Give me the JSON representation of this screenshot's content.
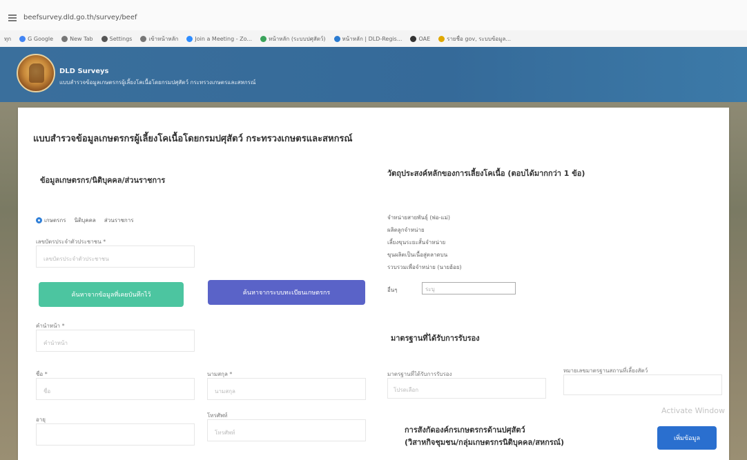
{
  "browser": {
    "url": "beefsurvey.dld.go.th/survey/beef",
    "bookmarks": [
      {
        "label": "G Google",
        "icon": "google-icon",
        "color": "#4285f4"
      },
      {
        "label": "New Tab",
        "icon": "globe-icon",
        "color": "#777777"
      },
      {
        "label": "Settings",
        "icon": "gear-icon",
        "color": "#555555"
      },
      {
        "label": "เข้าหน้าหลัก",
        "icon": "globe-icon",
        "color": "#777777"
      },
      {
        "label": "Join a Meeting - Zo...",
        "icon": "zoom-icon",
        "color": "#2d8cff"
      },
      {
        "label": "หน้าหลัก (ระบบปศุสัตว์)",
        "icon": "leaf-icon",
        "color": "#3aa35b"
      },
      {
        "label": "หน้าหลัก | DLD-Regis...",
        "icon": "grid-icon",
        "color": "#2a7bd1"
      },
      {
        "label": "OAE",
        "icon": "globe-icon",
        "color": "#333333"
      },
      {
        "label": "รายชื่อ gov, ระบบข้อมูล...",
        "icon": "apps-icon",
        "color": "#e0a800"
      }
    ]
  },
  "header": {
    "title": "DLD Surveys",
    "subtitle": "แบบสำรวจข้อมูลเกษตรกรผู้เลี้ยงโคเนื้อโดยกรมปศุสัตว์ กระทรวงเกษตรและสหกรณ์",
    "logo": "dld-seal"
  },
  "form": {
    "title": "แบบสำรวจข้อมูลเกษตรกรผู้เลี้ยงโคเนื้อโดยกรมปศุสัตว์ กระทรวงเกษตรและสหกรณ์",
    "farmer_section": {
      "title": "ข้อมูลเกษตรกร/นิติบุคคล/ส่วนราชการ",
      "radio_options": [
        "เกษตรกร",
        "นิติบุคคล",
        "ส่วนราชการ"
      ],
      "selected": "เกษตรกร",
      "id_label": "เลขบัตรประจำตัวประชาชน *",
      "id_placeholder": "เลขบัตรประจำตัวประชาชน",
      "search_registered_btn": "ค้นหาจากข้อมูลที่เคยบันทึกไว้",
      "search_registry_btn": "ค้นหาจากระบบทะเบียนเกษตรกร",
      "prefix_label": "คำนำหน้า *",
      "prefix_placeholder": "คำนำหน้า",
      "firstname_label": "ชื่อ *",
      "firstname_placeholder": "ชื่อ",
      "lastname_label": "นามสกุล *",
      "lastname_placeholder": "นามสกุล",
      "age_label": "อายุ",
      "phone_label": "โทรศัพท์",
      "phone_placeholder": "โทรศัพท์"
    },
    "purpose_section": {
      "title": "วัตถุประสงค์หลักของการเลี้ยงโคเนื้อ (ตอบได้มากกว่า 1 ข้อ)",
      "options": [
        "จำหน่ายสายพันธุ์ (พ่อ-แม่)",
        "ผลิตลูกจำหน่าย",
        "เลี้ยงขุนระยะสั้นจำหน่าย",
        "ขุนผลิตเป็นเนื้อสู่ตลาดบน",
        "รวบรวมเพื่อจำหน่าย (นายฮ้อย)"
      ],
      "other_label": "อื่นๆ",
      "other_placeholder": "ระบุ"
    },
    "standards_section": {
      "title": "มาตรฐานที่ได้รับการรับรอง",
      "standard_label": "มาตรฐานที่ได้รับการรับรอง",
      "standard_placeholder": "โปรดเลือก",
      "certificate_label": "หมายเลขมาตรฐานสถานที่เลี้ยงสัตว์"
    },
    "affiliation_section": {
      "title_line1": "การสังกัดองค์กรเกษตรกรด้านปศุสัตว์",
      "title_line2": "(วิสาหกิจชุมชน/กลุ่มเกษตรกรนิติบุคคล/สหกรณ์)",
      "add_btn": "เพิ่มข้อมูล"
    }
  },
  "watermark": "Activate Window",
  "colors": {
    "header_bg": "#356a99",
    "btn_green": "#4cc5a0",
    "btn_purple": "#5a63c8",
    "btn_blue": "#2a6fcf",
    "radio_selected": "#2f7fd8"
  }
}
